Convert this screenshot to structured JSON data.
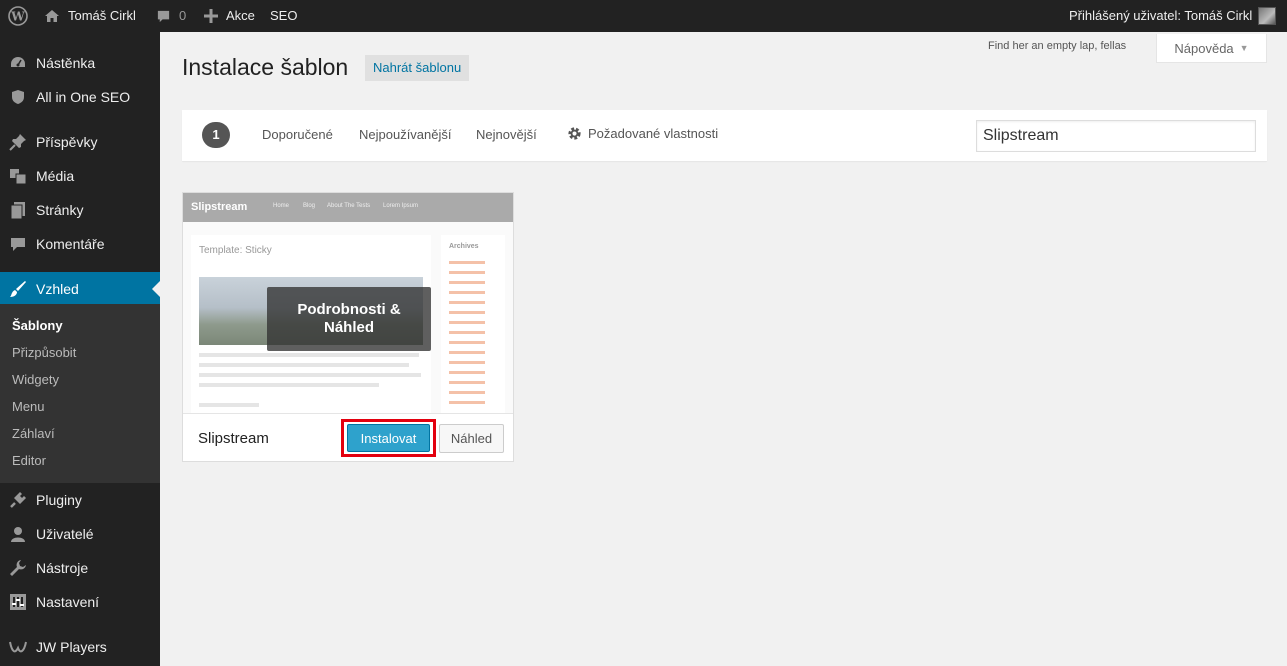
{
  "adminbar": {
    "site_name": "Tomáš Cirkl",
    "comments_count": "0",
    "new_label": "Akce",
    "seo_label": "SEO",
    "user_greeting": "Přihlášený uživatel: Tomáš Cirkl"
  },
  "sidebar": {
    "items": [
      {
        "label": "Nástěnka",
        "icon": "dashboard-icon"
      },
      {
        "label": "All in One SEO",
        "icon": "shield-icon"
      },
      {
        "label": "Příspěvky",
        "icon": "pin-icon"
      },
      {
        "label": "Média",
        "icon": "media-icon"
      },
      {
        "label": "Stránky",
        "icon": "page-icon"
      },
      {
        "label": "Komentáře",
        "icon": "comment-icon"
      },
      {
        "label": "Vzhled",
        "icon": "brush-icon"
      },
      {
        "label": "Pluginy",
        "icon": "plugin-icon"
      },
      {
        "label": "Uživatelé",
        "icon": "user-icon"
      },
      {
        "label": "Nástroje",
        "icon": "wrench-icon"
      },
      {
        "label": "Nastavení",
        "icon": "settings-icon"
      },
      {
        "label": "JW Players",
        "icon": "player-icon"
      }
    ],
    "submenu": [
      "Šablony",
      "Přizpůsobit",
      "Widgety",
      "Menu",
      "Záhlaví",
      "Editor"
    ]
  },
  "header": {
    "title": "Instalace šablon",
    "upload_button": "Nahrát šablonu",
    "screen_text": "Find her an empty lap, fellas",
    "help_button": "Nápověda"
  },
  "filter": {
    "count": "1",
    "links": [
      "Doporučené",
      "Nejpoužívanější",
      "Nejnovější"
    ],
    "feature_filter": "Požadované vlastnosti",
    "search_value": "Slipstream"
  },
  "theme": {
    "name": "Slipstream",
    "overlay_text": "Podrobnosti & Náhled",
    "install_button": "Instalovat",
    "preview_button": "Náhled",
    "screenshot": {
      "brand": "Slipstream",
      "nav": [
        "Home",
        "Blog",
        "About The Tests",
        "Lorem Ipsum"
      ],
      "post_title": "Template: Sticky",
      "archives_title": "Archives"
    }
  },
  "colors": {
    "accent": "#0074a2",
    "install": "#2ea2cc",
    "highlight": "#e3000f",
    "adminbar": "#222222"
  }
}
